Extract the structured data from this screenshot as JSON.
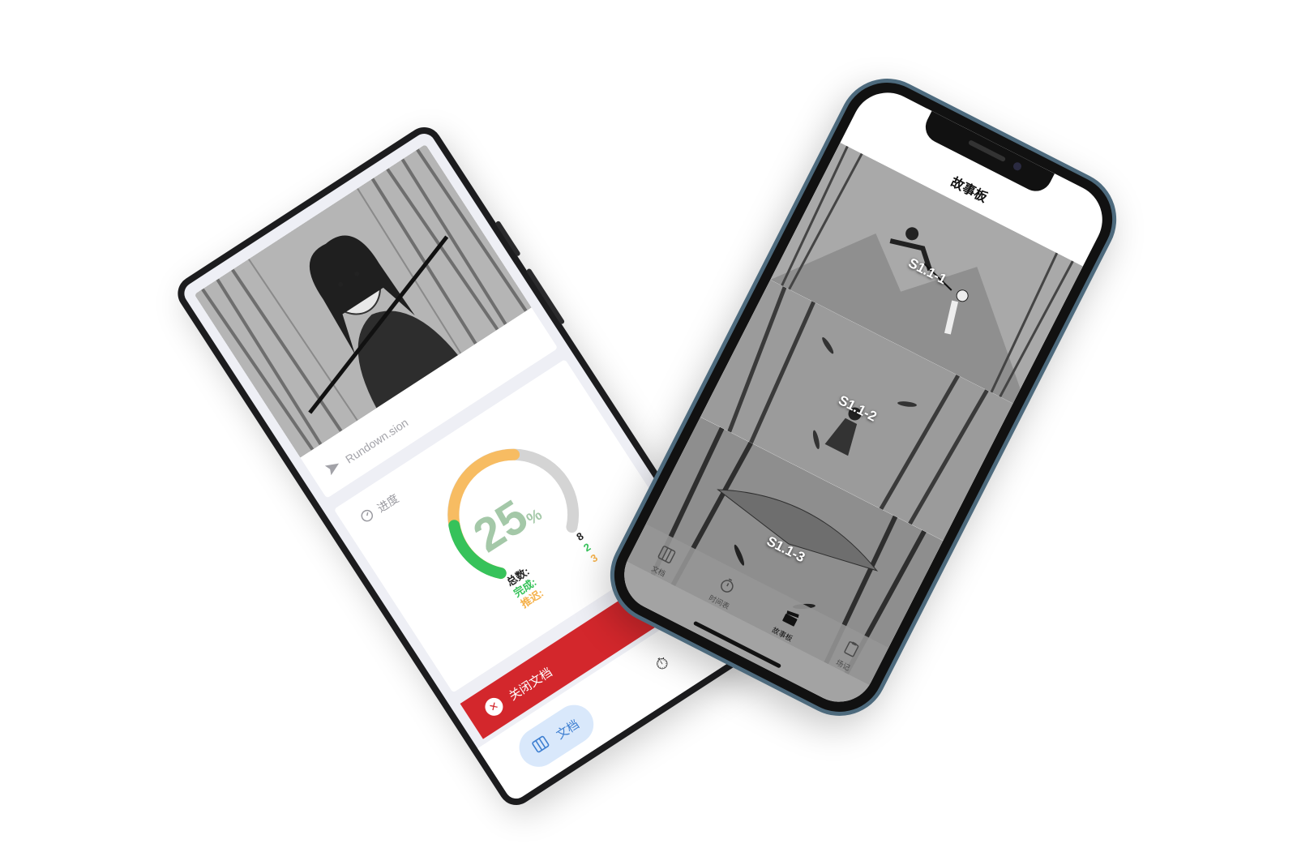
{
  "android_app": {
    "document": {
      "file_name": "Rundown.sion"
    },
    "progress": {
      "label": "进度",
      "percent": "25",
      "percent_sign": "%",
      "completion_fraction": 0.25,
      "deferred_fraction": 0.375,
      "stats": [
        {
          "label": "总数:",
          "value": "8",
          "color": "#222222"
        },
        {
          "label": "完成:",
          "value": "2",
          "color": "#36c25a"
        },
        {
          "label": "推迟:",
          "value": "3",
          "color": "#f5b24d"
        }
      ],
      "colors": {
        "complete": "#36c25a",
        "deferred": "#f7bc62",
        "remaining": "#d4d4d4"
      }
    },
    "close_button": {
      "label": "关闭文档",
      "color": "#d3272c"
    },
    "tabbar": {
      "active_label": "文档",
      "timer_icon": "⏱"
    }
  },
  "ios_app": {
    "title": "故事板",
    "panels": [
      {
        "label": "S1.1-1"
      },
      {
        "label": "S1.1-2"
      },
      {
        "label": "S1.1-3"
      }
    ],
    "tabbar": [
      {
        "label": "文档",
        "icon": "columns-icon"
      },
      {
        "label": "时间表",
        "icon": "timer-icon"
      },
      {
        "label": "故事板",
        "icon": "clapperboard-icon",
        "active": true
      },
      {
        "label": "场记",
        "icon": "clipboard-icon"
      }
    ]
  }
}
